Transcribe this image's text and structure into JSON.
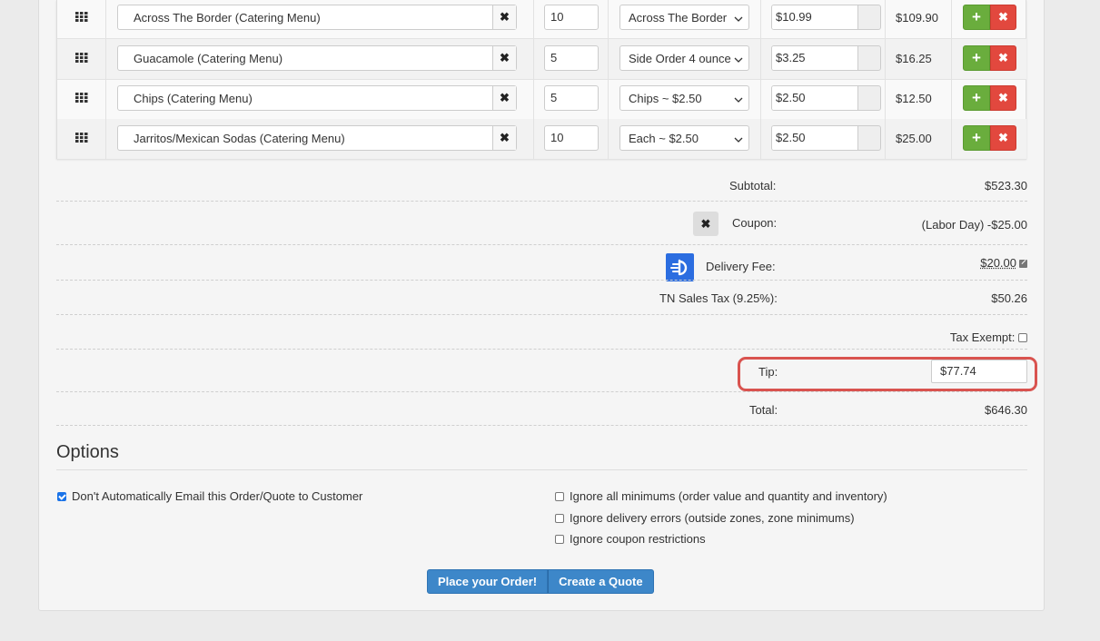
{
  "items": [
    {
      "name": "Across The Border (Catering Menu)",
      "qty": "10",
      "option": "Across The Border",
      "price": "$10.99",
      "total": "$109.90"
    },
    {
      "name": "Guacamole (Catering Menu)",
      "qty": "5",
      "option": "Side Order 4 ounce",
      "price": "$3.25",
      "total": "$16.25"
    },
    {
      "name": "Chips (Catering Menu)",
      "qty": "5",
      "option": "Chips ~ $2.50",
      "price": "$2.50",
      "total": "$12.50"
    },
    {
      "name": "Jarritos/Mexican Sodas (Catering Menu)",
      "qty": "10",
      "option": "Each ~ $2.50",
      "price": "$2.50",
      "total": "$25.00"
    }
  ],
  "icons": {
    "drag": "grid-drag-icon",
    "remove": "x-icon",
    "add": "plus-icon",
    "chevron": "chevron-down-icon",
    "delivery_service": "doordash-logo-icon",
    "edit": "edit-icon"
  },
  "glyphs": {
    "remove": "✖",
    "add": "+"
  },
  "summary": {
    "subtotal_label": "Subtotal:",
    "subtotal_value": "$523.30",
    "coupon_label": "Coupon:",
    "coupon_value": "(Labor Day) -$25.00",
    "delivery_label": "Delivery Fee:",
    "delivery_value": "$20.00",
    "tax_label": "TN Sales Tax (9.25%):",
    "tax_value": "$50.26",
    "tax_exempt_label": "Tax Exempt:",
    "tip_label": "Tip:",
    "tip_value": "$77.74",
    "total_label": "Total:",
    "total_value": "$646.30"
  },
  "options": {
    "title": "Options",
    "no_email": "Don't Automatically Email this Order/Quote to Customer",
    "ignore_minimums": "Ignore all minimums (order value and quantity and inventory)",
    "ignore_delivery_errors": "Ignore delivery errors (outside zones, zone minimums)",
    "ignore_coupon": "Ignore coupon restrictions"
  },
  "actions": {
    "place_order": "Place your Order!",
    "create_quote": "Create a Quote"
  },
  "colors": {
    "accent_blue": "#3d87c9",
    "add_green": "#6aad3d",
    "delete_red": "#e2483e",
    "highlight_red": "#d9534f",
    "doordash_blue": "#2b6de0"
  }
}
